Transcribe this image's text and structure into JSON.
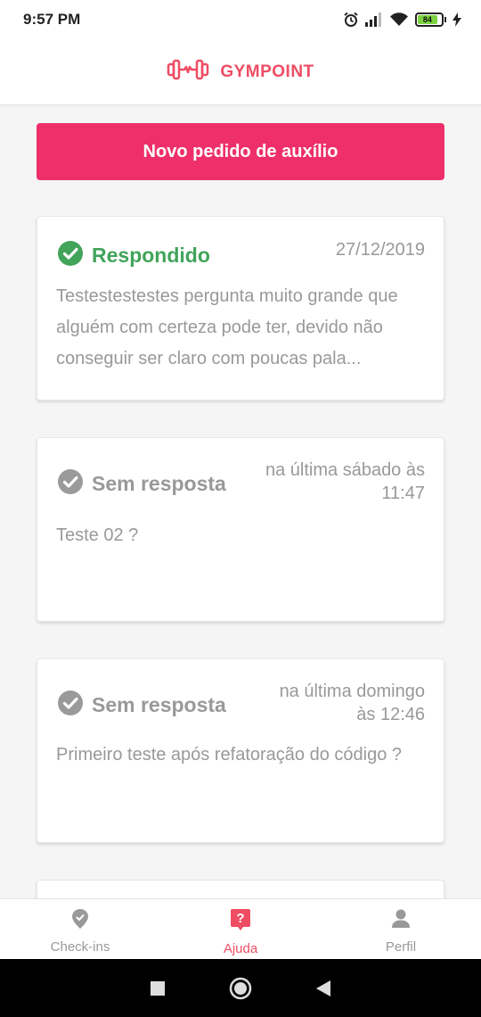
{
  "status_bar": {
    "time": "9:57 PM",
    "battery_level": "84",
    "icons": [
      "alarm-icon",
      "signal-icon",
      "wifi-icon",
      "battery-icon",
      "charging-icon"
    ]
  },
  "header": {
    "brand_name": "GYMPOINT",
    "logo_icon": "dumbbell-icon"
  },
  "main": {
    "new_request_label": "Novo pedido de auxílio",
    "help_orders": [
      {
        "status": "Respondido",
        "status_icon": "check-circle-icon",
        "date_lines": [
          "27/12/2019"
        ],
        "question": "Testestestestes pergunta muito grande que alguém com certeza pode ter, devido não conseguir ser claro com poucas pala..."
      },
      {
        "status": "Sem resposta",
        "status_icon": "check-circle-icon",
        "date_lines": [
          "na última sábado às",
          "11:47"
        ],
        "question": "Teste 02 ?"
      },
      {
        "status": "Sem resposta",
        "status_icon": "check-circle-icon",
        "date_lines": [
          "na última domingo",
          "às 12:46"
        ],
        "question": "Primeiro teste após refatoração do código ?"
      }
    ]
  },
  "tab_bar": {
    "tabs": [
      {
        "label": "Check-ins",
        "icon": "location-pin-icon",
        "active": false
      },
      {
        "label": "Ajuda",
        "icon": "help-bubble-icon",
        "active": true
      },
      {
        "label": "Perfil",
        "icon": "person-icon",
        "active": false
      }
    ]
  },
  "colors": {
    "brand": "#ee4d64",
    "primary_button": "#ee2f6a",
    "answered": "#42a45b",
    "muted": "#999999"
  }
}
